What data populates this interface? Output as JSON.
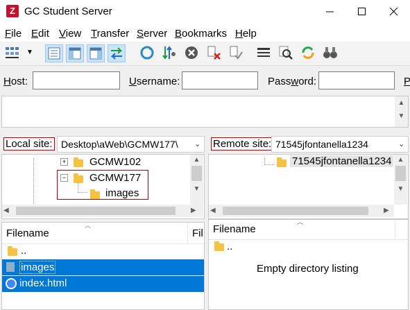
{
  "window": {
    "title": "GC Student Server",
    "app_icon_letter": "Z"
  },
  "menu": {
    "items": [
      {
        "underline": "F",
        "rest": "ile"
      },
      {
        "underline": "E",
        "rest": "dit"
      },
      {
        "underline": "V",
        "rest": "iew"
      },
      {
        "underline": "T",
        "rest": "ransfer"
      },
      {
        "underline": "S",
        "rest": "erver"
      },
      {
        "underline": "B",
        "rest": "ookmarks"
      },
      {
        "underline": "H",
        "rest": "elp"
      }
    ]
  },
  "quickconnect": {
    "host_label_u": "H",
    "host_label_rest": "ost:",
    "username_label_u": "U",
    "username_label_rest": "sername:",
    "password_label_pre": "Pass",
    "password_label_u": "w",
    "password_label_rest": "ord:",
    "port_label_u": "P",
    "host_value": "",
    "username_value": "",
    "password_value": ""
  },
  "local": {
    "site_label": "Local site:",
    "path": "Desktop\\aWeb\\GCMW177\\",
    "tree": {
      "item1": "GCMW102",
      "item2": "GCMW177",
      "item3": "images"
    },
    "list": {
      "header": "Filename",
      "header2": "Fil",
      "rows": [
        "..",
        "images",
        "index.html"
      ]
    }
  },
  "remote": {
    "site_label": "Remote site:",
    "path": "71545jfontanella1234",
    "tree_item": "71545jfontanella1234",
    "list": {
      "header": "Filename",
      "rows": [
        ".."
      ],
      "empty_message": "Empty directory listing"
    }
  }
}
